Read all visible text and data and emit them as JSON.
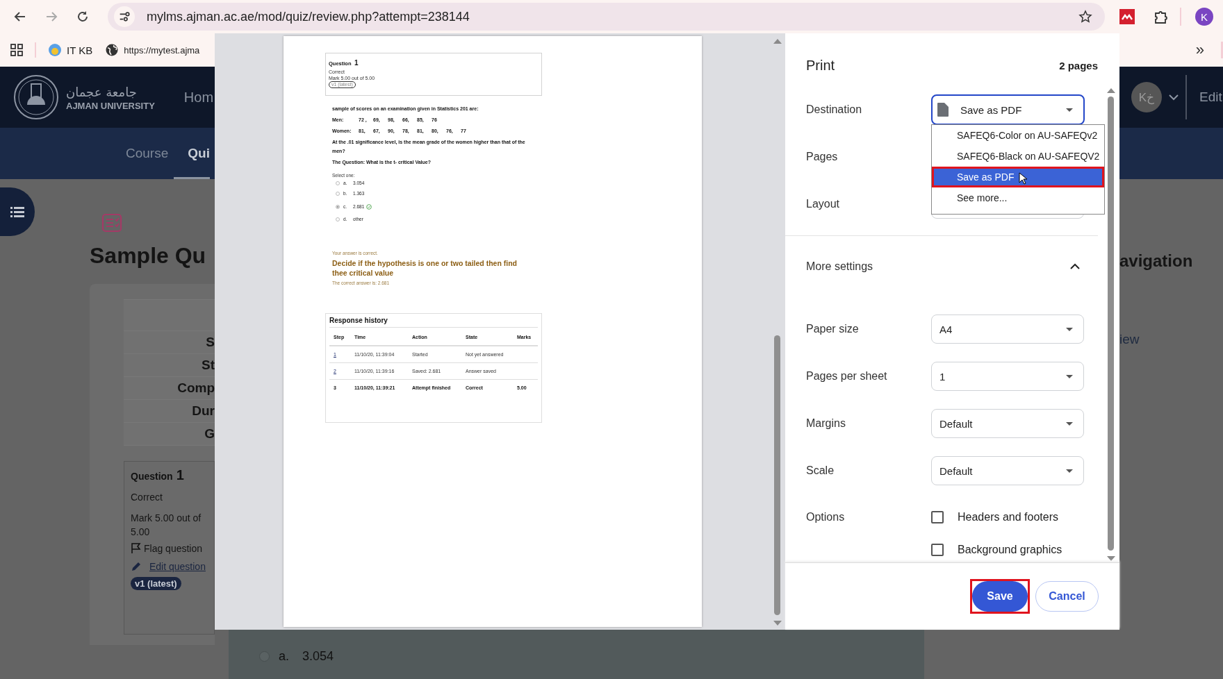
{
  "browser": {
    "forward_disabled": true,
    "address": "mylms.ajman.ac.ae/mod/quiz/review.php?attempt=238144",
    "profile_initial": "K",
    "bookmarks": [
      {
        "label": "IT KB",
        "kind": "avatar"
      },
      {
        "label": "https://mytest.ajma",
        "kind": "globe"
      }
    ],
    "overflow": "»"
  },
  "site": {
    "logo_arabic": "جامعة عجمان",
    "logo_english": "AJMAN UNIVERSITY",
    "nav_left": "Hom",
    "user_initials": "Kخ",
    "nav_right": "Edit",
    "subnav": [
      {
        "label": "Course",
        "selected": false
      },
      {
        "label": "Qui",
        "selected": true
      }
    ],
    "page_title": "Sample Qu",
    "summary_rows": [
      "S",
      "St",
      "Comp",
      "Dur",
      "G"
    ],
    "question_info": {
      "title": "Question",
      "number": "1",
      "status": "Correct",
      "mark": "Mark 5.00 out of 5.00",
      "flag": "Flag question",
      "edit": "Edit question",
      "version": "v1 (latest)"
    },
    "right_heading": "avigation",
    "right_link": "iew",
    "options": [
      {
        "letter": "a.",
        "text": "3.054",
        "selected": false
      }
    ]
  },
  "preview": {
    "question_box": {
      "title": "Question",
      "number": "1",
      "status": "Correct",
      "mark": "Mark 5.00 out of 5.00",
      "version": "v1 (latest)"
    },
    "intro": "sample of scores on an examination given in Statistics 201 are:",
    "score_lines": [
      {
        "label": "Men:",
        "values": [
          "72 ,",
          "69,",
          "98,",
          "66,",
          "85,",
          "76"
        ]
      },
      {
        "label": "Women:",
        "values": [
          "81,",
          "67,",
          "90,",
          "78,",
          "81,",
          "80,",
          "76,",
          "77"
        ]
      }
    ],
    "question": "At the .01 significance level, is the mean grade of the women higher than that of the men?",
    "ask": "The Question: What is the t- critical Value?",
    "select_one": "Select one:",
    "options": [
      {
        "letter": "a.",
        "text": "3.054",
        "selected": false,
        "correct": false
      },
      {
        "letter": "b.",
        "text": "1.363",
        "selected": false,
        "correct": false
      },
      {
        "letter": "c.",
        "text": "2.681",
        "selected": true,
        "correct": true
      },
      {
        "letter": "d.",
        "text": "other",
        "selected": false,
        "correct": false
      }
    ],
    "feedback": "Your answer is correct.",
    "general_feedback": "Decide if the hypothesis is one or two tailed then find thee critical value",
    "right_answer": "The correct answer is: 2.681",
    "history": {
      "title": "Response history",
      "columns": [
        "Step",
        "Time",
        "Action",
        "State",
        "Marks"
      ],
      "rows": [
        {
          "step": "1",
          "step_link": true,
          "time": "11/10/20, 11:39:04",
          "action": "Started",
          "state": "Not yet answered",
          "bold": false
        },
        {
          "step": "2",
          "step_link": true,
          "time": "11/10/20, 11:39:16",
          "action": "Saved: 2.681",
          "state": "Answer saved",
          "bold": false
        },
        {
          "step": "3",
          "step_link": false,
          "time": "11/10/20, 11:39:21",
          "action": "Attempt finished",
          "state": "Correct",
          "marks": "5.00",
          "bold": true
        }
      ]
    }
  },
  "print": {
    "title": "Print",
    "page_count": "2 pages",
    "destination": {
      "label": "Destination",
      "value": "Save as PDF",
      "menu": [
        {
          "label": "SAFEQ6-Color on AU-SAFEQv2",
          "selected": false,
          "highlighted": false
        },
        {
          "label": "SAFEQ6-Black on AU-SAFEQV2",
          "selected": false,
          "highlighted": false
        },
        {
          "label": "Save as PDF",
          "selected": true,
          "highlighted": true
        },
        {
          "label": "See more...",
          "selected": false,
          "highlighted": false
        }
      ]
    },
    "pages_label": "Pages",
    "layout_label": "Layout",
    "more_settings": {
      "label": "More settings",
      "expanded": true
    },
    "selects": [
      {
        "label": "Paper size",
        "value": "A4"
      },
      {
        "label": "Pages per sheet",
        "value": "1"
      },
      {
        "label": "Margins",
        "value": "Default"
      },
      {
        "label": "Scale",
        "value": "Default"
      }
    ],
    "options_label": "Options",
    "checkboxes": [
      {
        "label": "Headers and footers",
        "checked": false
      },
      {
        "label": "Background graphics",
        "checked": false
      }
    ],
    "buttons": [
      {
        "label": "Save",
        "kind": "primary",
        "highlighted": true
      },
      {
        "label": "Cancel",
        "kind": "secondary",
        "highlighted": false
      }
    ]
  }
}
